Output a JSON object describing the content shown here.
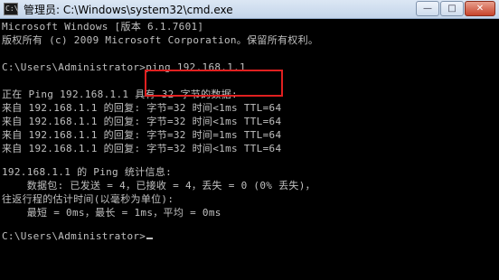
{
  "window": {
    "title": "管理员: C:\\Windows\\system32\\cmd.exe",
    "icon": "cmd-icon",
    "controls": {
      "minimize": "—",
      "maximize": "□",
      "close": "✕"
    }
  },
  "console": {
    "lines": [
      "Microsoft Windows [版本 6.1.7601]",
      "版权所有 (c) 2009 Microsoft Corporation。保留所有权利。",
      "",
      "C:\\Users\\Administrator>ping 192.168.1.1",
      "",
      "正在 Ping 192.168.1.1 具有 32 字节的数据:",
      "来自 192.168.1.1 的回复: 字节=32 时间<1ms TTL=64",
      "来自 192.168.1.1 的回复: 字节=32 时间<1ms TTL=64",
      "来自 192.168.1.1 的回复: 字节=32 时间=1ms TTL=64",
      "来自 192.168.1.1 的回复: 字节=32 时间<1ms TTL=64",
      "",
      "192.168.1.1 的 Ping 统计信息:",
      "    数据包: 已发送 = 4，已接收 = 4，丢失 = 0 (0% 丢失)，",
      "往返行程的估计时间(以毫秒为单位):",
      "    最短 = 0ms，最长 = 1ms，平均 = 0ms",
      "",
      "C:\\Users\\Administrator>"
    ]
  },
  "colors": {
    "background": "#000000",
    "text": "#c0c0c0",
    "highlight": "#e02020"
  }
}
